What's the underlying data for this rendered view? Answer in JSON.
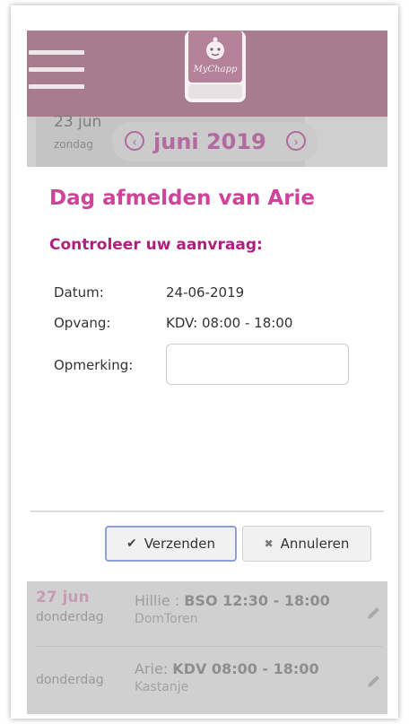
{
  "header": {
    "logo_text": "MyChapp",
    "date_day": "23 jun",
    "date_weekday": "zondag",
    "month_label": "juni 2019"
  },
  "modal": {
    "title": "Dag afmelden van Arie",
    "subtitle": "Controleer uw aanvraag:",
    "date_label": "Datum:",
    "date_value": "24-06-2019",
    "care_label": "Opvang:",
    "care_value": "KDV: 08:00 - 18:00",
    "remark_label": "Opmerking:",
    "remark_value": "",
    "send_label": "Verzenden",
    "cancel_label": "Annuleren"
  },
  "list": [
    {
      "date": "27 jun",
      "weekday": "donderdag",
      "name": "Hillie :",
      "slot": "BSO 12:30 - 18:00",
      "location": "DomToren"
    },
    {
      "date": "",
      "weekday": "donderdag",
      "name": "Arie:",
      "slot": "KDV 08:00 - 18:00",
      "location": "Kastanje"
    }
  ],
  "colors": {
    "appbar": "#a87c8f",
    "accent": "#d0439a",
    "accent_dark": "#b01f7e"
  }
}
